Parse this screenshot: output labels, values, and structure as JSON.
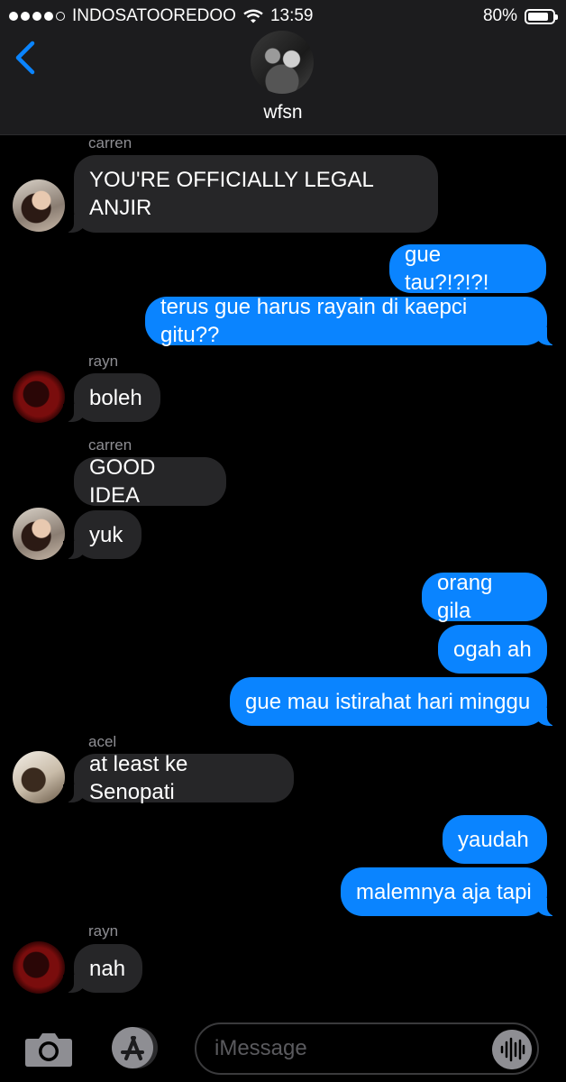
{
  "status_bar": {
    "carrier": "INDOSATOOREDOO",
    "time": "13:59",
    "battery": "80%",
    "battery_level": 0.8,
    "signal_bars_filled": 4,
    "signal_bars_total": 5
  },
  "header": {
    "group_name": "wfsn"
  },
  "messages": [
    {
      "sender": "carren",
      "text": "YOU'RE OFFICIALLY LEGAL\nANJIR",
      "direction": "incoming"
    },
    {
      "text": "gue tau?!?!?!",
      "direction": "outgoing"
    },
    {
      "text": "terus gue harus rayain di kaepci gitu??",
      "direction": "outgoing"
    },
    {
      "sender": "rayn",
      "text": "boleh",
      "direction": "incoming"
    },
    {
      "sender": "carren",
      "text": "GOOD IDEA",
      "direction": "incoming"
    },
    {
      "text": "yuk",
      "direction": "incoming"
    },
    {
      "text": "orang gila",
      "direction": "outgoing"
    },
    {
      "text": "ogah ah",
      "direction": "outgoing"
    },
    {
      "text": "gue mau istirahat hari minggu",
      "direction": "outgoing"
    },
    {
      "sender": "acel",
      "text": "at least ke Senopati",
      "direction": "incoming"
    },
    {
      "text": "yaudah",
      "direction": "outgoing"
    },
    {
      "text": "malemnya aja tapi",
      "direction": "outgoing"
    },
    {
      "sender": "rayn",
      "text": "nah",
      "direction": "incoming"
    }
  ],
  "input_bar": {
    "placeholder": "iMessage"
  },
  "colors": {
    "outgoing_bubble": "#0a84ff",
    "incoming_bubble": "#262628",
    "accent": "#0a84ff"
  },
  "icons": [
    "back-chevron-icon",
    "camera-icon",
    "app-store-icon",
    "audio-waveform-icon",
    "wifi-icon",
    "battery-icon"
  ]
}
